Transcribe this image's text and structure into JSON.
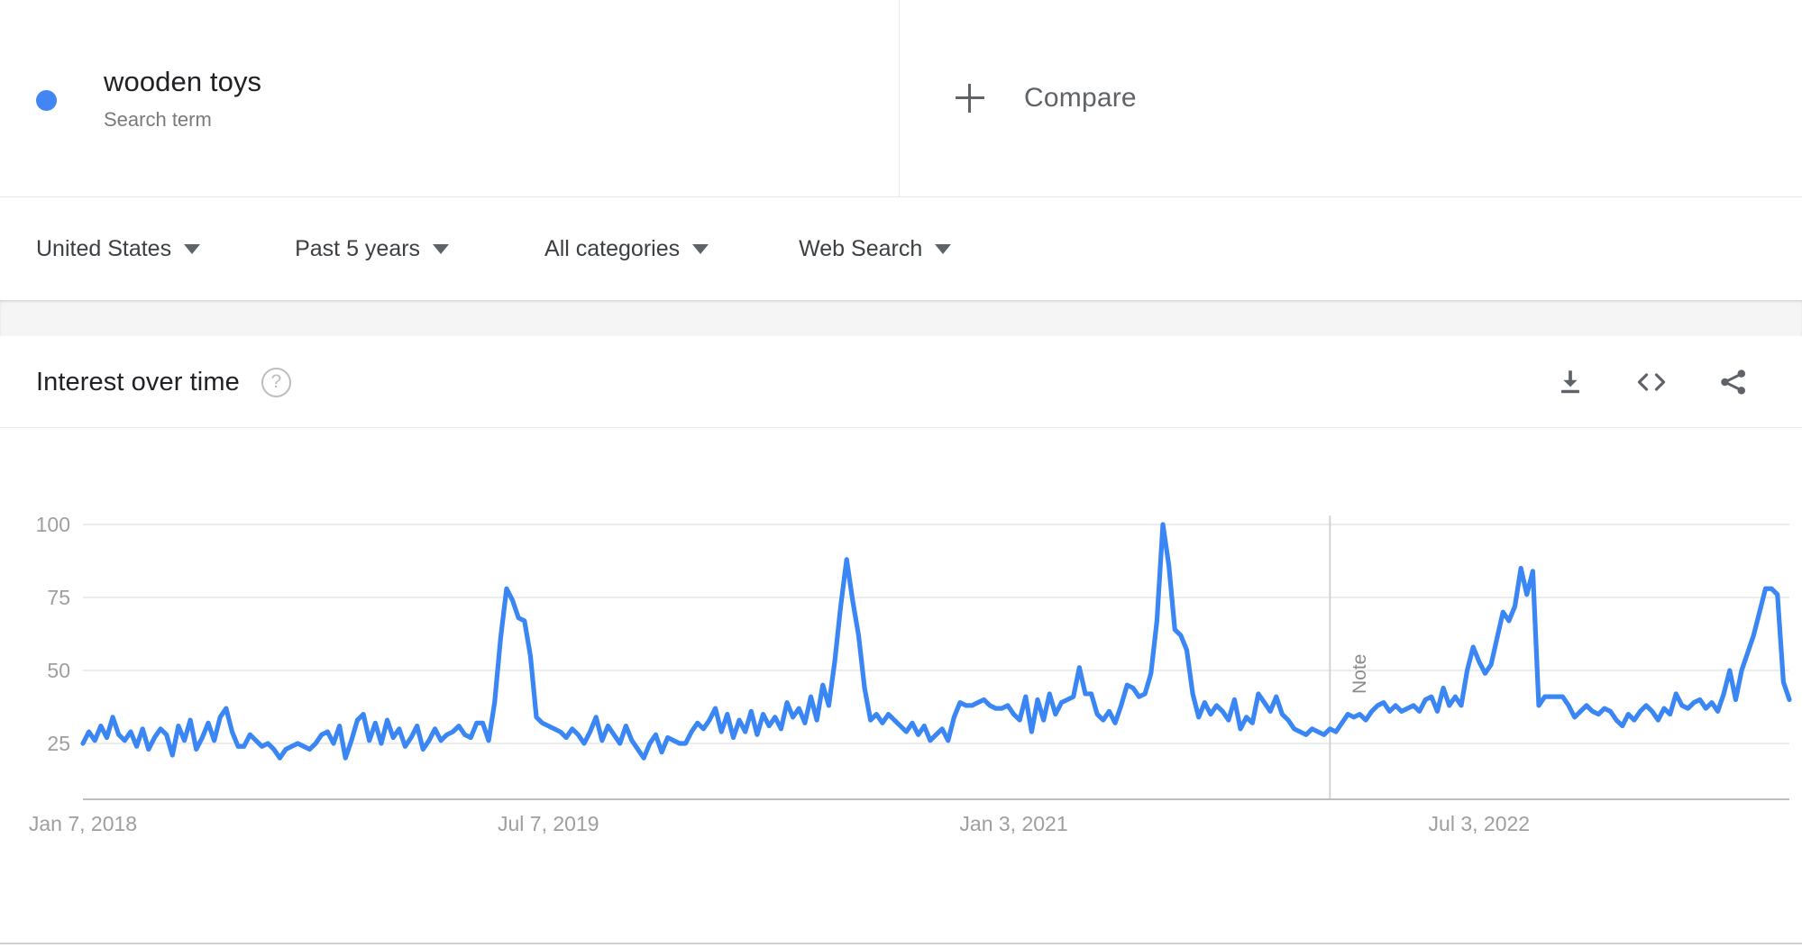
{
  "term": {
    "name": "wooden toys",
    "type_label": "Search term",
    "dot_color": "#4285F4"
  },
  "compare": {
    "label": "Compare",
    "icon": "plus-icon"
  },
  "filters": [
    {
      "label": "United States",
      "icon": "chevron-down-icon"
    },
    {
      "label": "Past 5 years",
      "icon": "chevron-down-icon"
    },
    {
      "label": "All categories",
      "icon": "chevron-down-icon"
    },
    {
      "label": "Web Search",
      "icon": "chevron-down-icon"
    }
  ],
  "card": {
    "title": "Interest over time",
    "help_icon": "help-circle-icon",
    "help_glyph": "?",
    "actions": [
      {
        "name": "download-icon",
        "tooltip": "Download"
      },
      {
        "name": "embed-code-icon",
        "tooltip": "Embed"
      },
      {
        "name": "share-icon",
        "tooltip": "Share"
      }
    ]
  },
  "chart_data": {
    "type": "line",
    "title": "Interest over time",
    "xlabel": "",
    "ylabel": "",
    "ylim": [
      0,
      105
    ],
    "grid": true,
    "legend": false,
    "line_color": "#3B86F5",
    "yticks": [
      25,
      50,
      75,
      100
    ],
    "xticks": [
      "Jan 7, 2018",
      "Jul 7, 2019",
      "Jan 3, 2021",
      "Jul 3, 2022"
    ],
    "xtick_positions": [
      0,
      78,
      156,
      234
    ],
    "annotations": [
      {
        "label": "Note",
        "x_index": 209,
        "type": "vertical-line"
      }
    ],
    "series": [
      {
        "name": "wooden toys",
        "values": [
          25,
          29,
          26,
          31,
          27,
          34,
          28,
          26,
          29,
          24,
          30,
          23,
          27,
          30,
          28,
          21,
          31,
          26,
          33,
          23,
          27,
          32,
          26,
          34,
          37,
          29,
          24,
          24,
          28,
          26,
          24,
          25,
          23,
          20,
          23,
          24,
          25,
          24,
          23,
          25,
          28,
          29,
          25,
          31,
          20,
          26,
          33,
          35,
          26,
          32,
          25,
          33,
          27,
          30,
          24,
          27,
          31,
          23,
          26,
          30,
          26,
          28,
          29,
          31,
          28,
          27,
          32,
          32,
          26,
          39,
          61,
          78,
          74,
          68,
          67,
          55,
          34,
          32,
          31,
          30,
          29,
          27,
          30,
          28,
          25,
          29,
          34,
          26,
          31,
          28,
          25,
          31,
          26,
          23,
          20,
          25,
          28,
          22,
          27,
          26,
          25,
          25,
          29,
          32,
          30,
          33,
          37,
          29,
          35,
          27,
          33,
          29,
          36,
          28,
          35,
          31,
          34,
          30,
          39,
          34,
          37,
          32,
          41,
          33,
          45,
          38,
          53,
          72,
          88,
          74,
          62,
          44,
          33,
          35,
          32,
          35,
          33,
          31,
          29,
          32,
          28,
          31,
          26,
          28,
          30,
          26,
          34,
          39,
          38,
          38,
          39,
          40,
          38,
          37,
          37,
          38,
          35,
          33,
          41,
          29,
          40,
          33,
          42,
          35,
          39,
          40,
          41,
          51,
          42,
          42,
          35,
          33,
          36,
          32,
          38,
          45,
          44,
          41,
          42,
          49,
          67,
          100,
          86,
          64,
          62,
          57,
          42,
          34,
          39,
          35,
          38,
          36,
          33,
          40,
          30,
          34,
          32,
          42,
          39,
          36,
          41,
          35,
          33,
          30,
          29,
          28,
          30,
          29,
          28,
          30,
          29,
          32,
          35,
          34,
          35,
          33,
          36,
          38,
          39,
          36,
          38,
          36,
          37,
          38,
          36,
          40,
          41,
          36,
          44,
          38,
          41,
          38,
          50,
          58,
          53,
          49,
          52,
          61,
          70,
          67,
          72,
          85,
          76,
          84,
          38,
          41,
          41,
          41,
          41,
          38,
          34,
          36,
          38,
          36,
          35,
          37,
          36,
          33,
          31,
          35,
          33,
          36,
          38,
          36,
          33,
          37,
          35,
          42,
          38,
          37,
          39,
          40,
          37,
          39,
          36,
          42,
          50,
          40,
          50,
          56,
          62,
          70,
          78,
          78,
          76,
          46,
          40
        ]
      }
    ]
  }
}
